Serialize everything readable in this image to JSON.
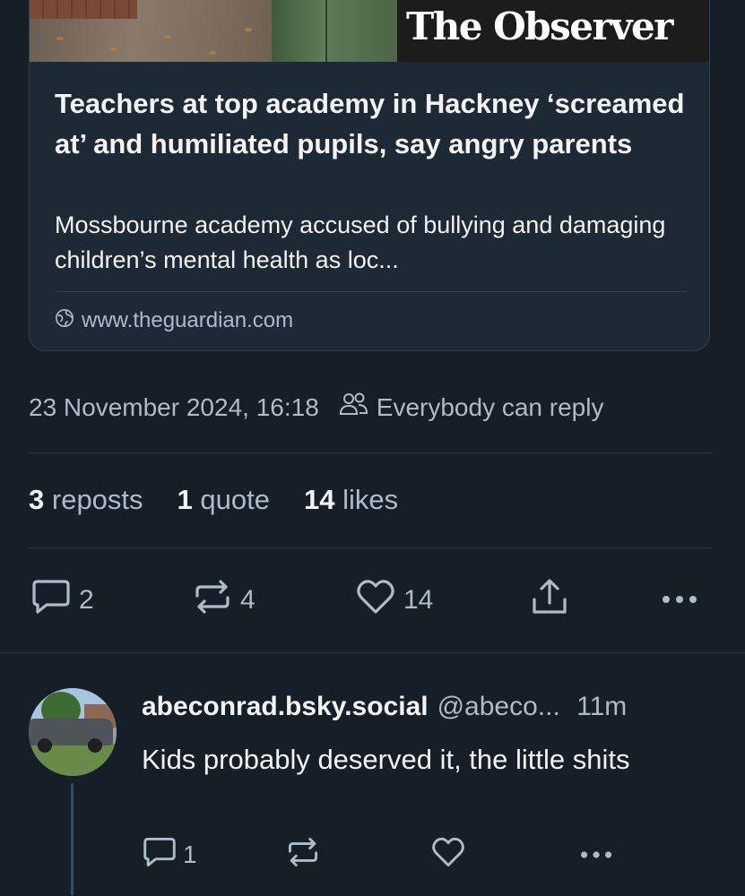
{
  "link_card": {
    "image_masthead": "The Observer",
    "title": "Teachers at top academy in Hackney ‘screamed at’ and humiliated pupils, say angry parents",
    "description": "Mossbourne academy accused of bullying and damaging children’s mental health as loc...",
    "domain": "www.theguardian.com",
    "domain_icon": "globe-icon"
  },
  "post_meta": {
    "timestamp": "23 November 2024, 16:18",
    "reply_setting_icon": "people-icon",
    "reply_setting": "Everybody can reply"
  },
  "stats": {
    "reposts_count": "3",
    "reposts_label": "reposts",
    "quotes_count": "1",
    "quotes_label": "quote",
    "likes_count": "14",
    "likes_label": "likes"
  },
  "actions": {
    "reply_count": "2",
    "repost_count": "4",
    "like_count": "14"
  },
  "reply": {
    "display_name": "abeconrad.bsky.social",
    "handle": "@abeco...",
    "time": "11m",
    "text": "Kids probably deserved it, the little shits",
    "reply_count": "1"
  },
  "colors": {
    "background": "#161e27",
    "card_background": "#1e2936",
    "text_primary": "#f1f3f5",
    "text_secondary": "#aebbc9",
    "divider": "#2a3848",
    "thread_line": "#2f4d66"
  }
}
